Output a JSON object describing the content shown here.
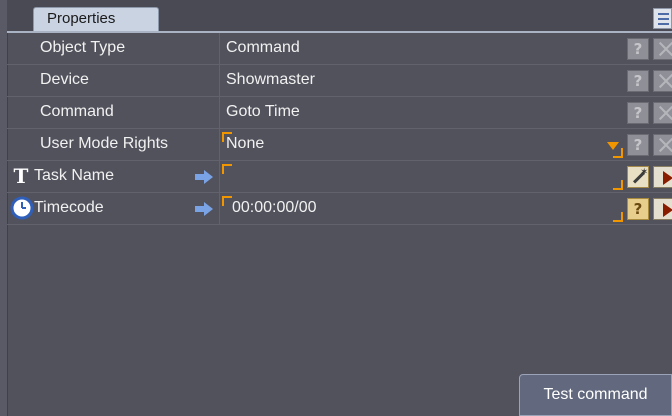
{
  "tab": {
    "label": "Properties"
  },
  "rows": [
    {
      "label": "Object Type",
      "value": "Command"
    },
    {
      "label": "Device",
      "value": "Showmaster"
    },
    {
      "label": "Command",
      "value": "Goto Time"
    },
    {
      "label": "User Mode Rights",
      "value": "None"
    },
    {
      "label": "Task Name",
      "value": ""
    },
    {
      "label": "Timecode",
      "value": "00:00:00/00"
    }
  ],
  "help_glyph": "?",
  "test_button": {
    "label": "Test command"
  },
  "colors": {
    "background": "#52525d",
    "accent": "#f29600",
    "tab": "#c9d3e2",
    "button": "#62697e"
  }
}
